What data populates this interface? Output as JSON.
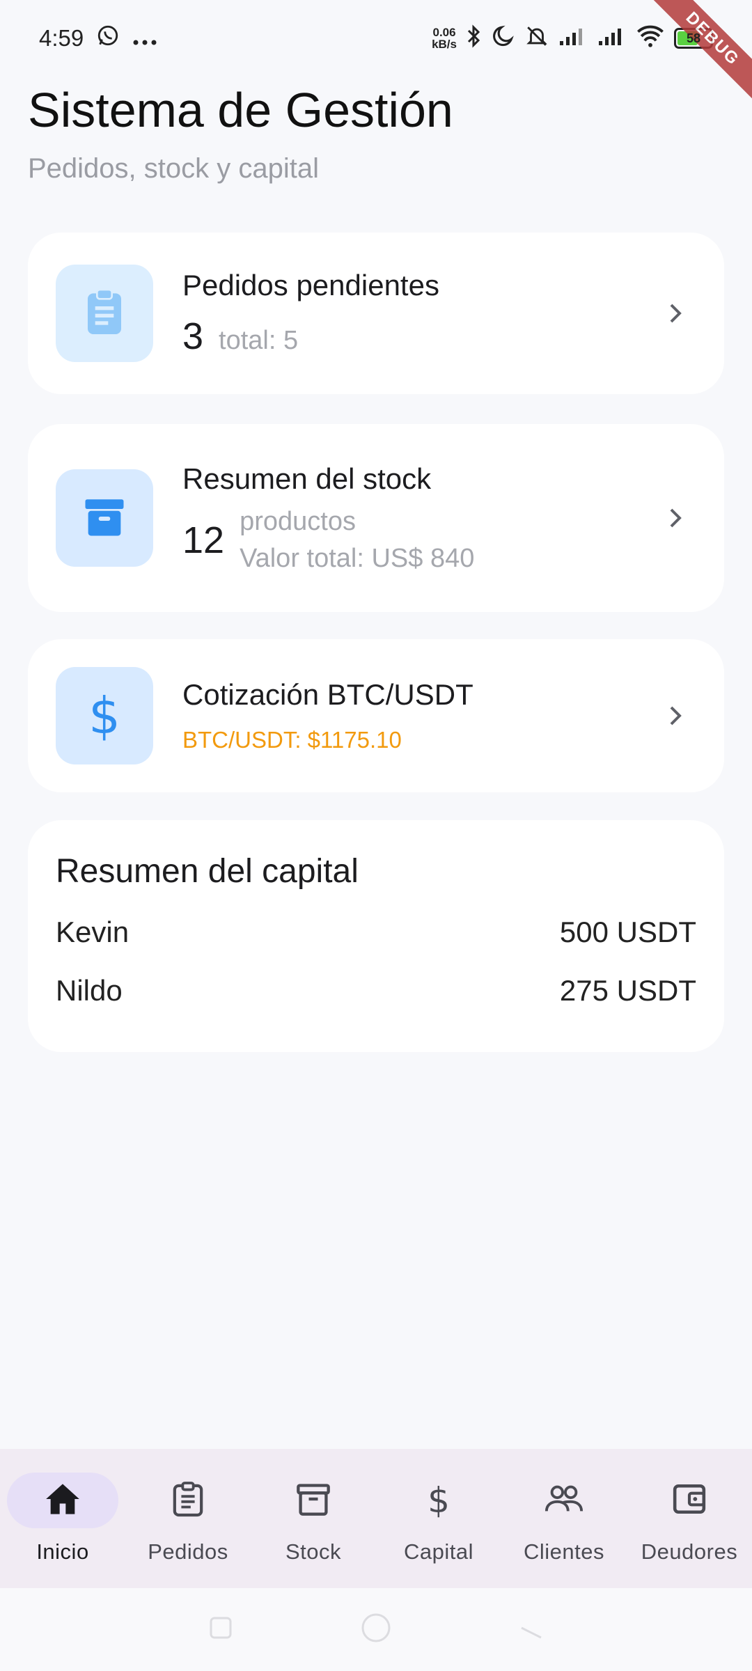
{
  "status_bar": {
    "time": "4:59",
    "net_speed_value": "0.06",
    "net_speed_unit": "kB/s",
    "battery": "58",
    "debug_label": "DEBUG"
  },
  "header": {
    "title": "Sistema de Gestión",
    "subtitle": "Pedidos, stock y capital"
  },
  "orders_card": {
    "title": "Pedidos pendientes",
    "count": "3",
    "total_label": "total: 5"
  },
  "stock_card": {
    "title": "Resumen del stock",
    "count": "12",
    "products_label": "productos",
    "value_label": "Valor total: US$ 840"
  },
  "btc_card": {
    "title": "Cotización BTC/USDT",
    "quote": "BTC/USDT: $1175.10",
    "quote_color": "#f29a0e"
  },
  "capital_card": {
    "title": "Resumen del capital",
    "rows": [
      {
        "name": "Kevin",
        "amount": "500 USDT"
      },
      {
        "name": "Nildo",
        "amount": "275 USDT"
      }
    ]
  },
  "bottom_nav": {
    "items": [
      {
        "label": "Inicio",
        "icon": "home-icon"
      },
      {
        "label": "Pedidos",
        "icon": "clipboard-icon"
      },
      {
        "label": "Stock",
        "icon": "archive-box-icon"
      },
      {
        "label": "Capital",
        "icon": "dollar-icon"
      },
      {
        "label": "Clientes",
        "icon": "people-icon"
      },
      {
        "label": "Deudores",
        "icon": "wallet-icon"
      }
    ],
    "active_index": 0
  },
  "colors": {
    "accent_blue": "#2f8ff0",
    "icon_bg": "#d8eaff",
    "nav_active_bg": "#e6dff7"
  }
}
